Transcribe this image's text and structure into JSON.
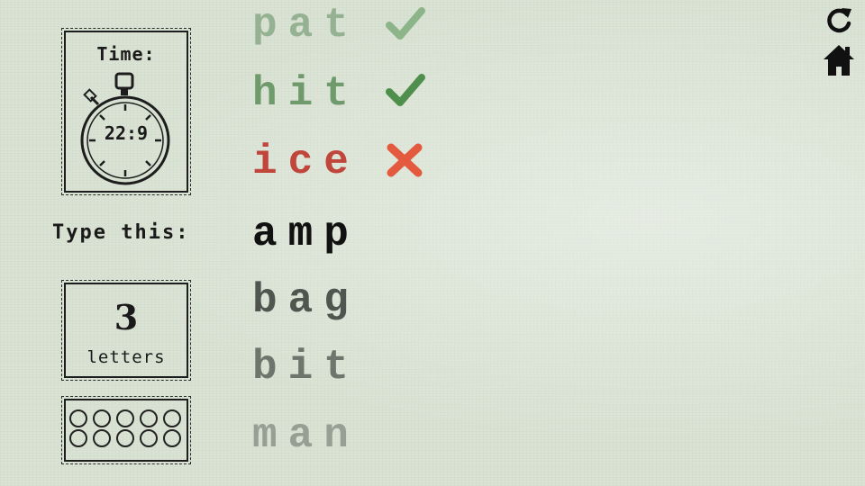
{
  "timer": {
    "label": "Time:",
    "value": "22:9"
  },
  "prompt": {
    "label": "Type this:"
  },
  "letters": {
    "count": "3",
    "label": "letters"
  },
  "dots": {
    "rows": 2,
    "per_row": 5
  },
  "words": {
    "completed": [
      {
        "text": "pat",
        "status": "correct",
        "color": "#7fa27d"
      },
      {
        "text": "hit",
        "status": "correct",
        "color": "#6f9a6c"
      },
      {
        "text": "ice",
        "status": "wrong",
        "color": "#c0463b"
      }
    ],
    "current": {
      "text": "amp",
      "color": "#111111"
    },
    "upcoming": [
      {
        "text": "bag",
        "color": "#505550"
      },
      {
        "text": "bit",
        "color": "#6e756d"
      },
      {
        "text": "man",
        "color": "#979f95"
      }
    ]
  },
  "colors": {
    "check": "#4f8f4c",
    "cross": "#e45a3e"
  },
  "icons": [
    "refresh-icon",
    "home-icon",
    "checkmark-icon",
    "cross-icon",
    "stopwatch-icon"
  ]
}
